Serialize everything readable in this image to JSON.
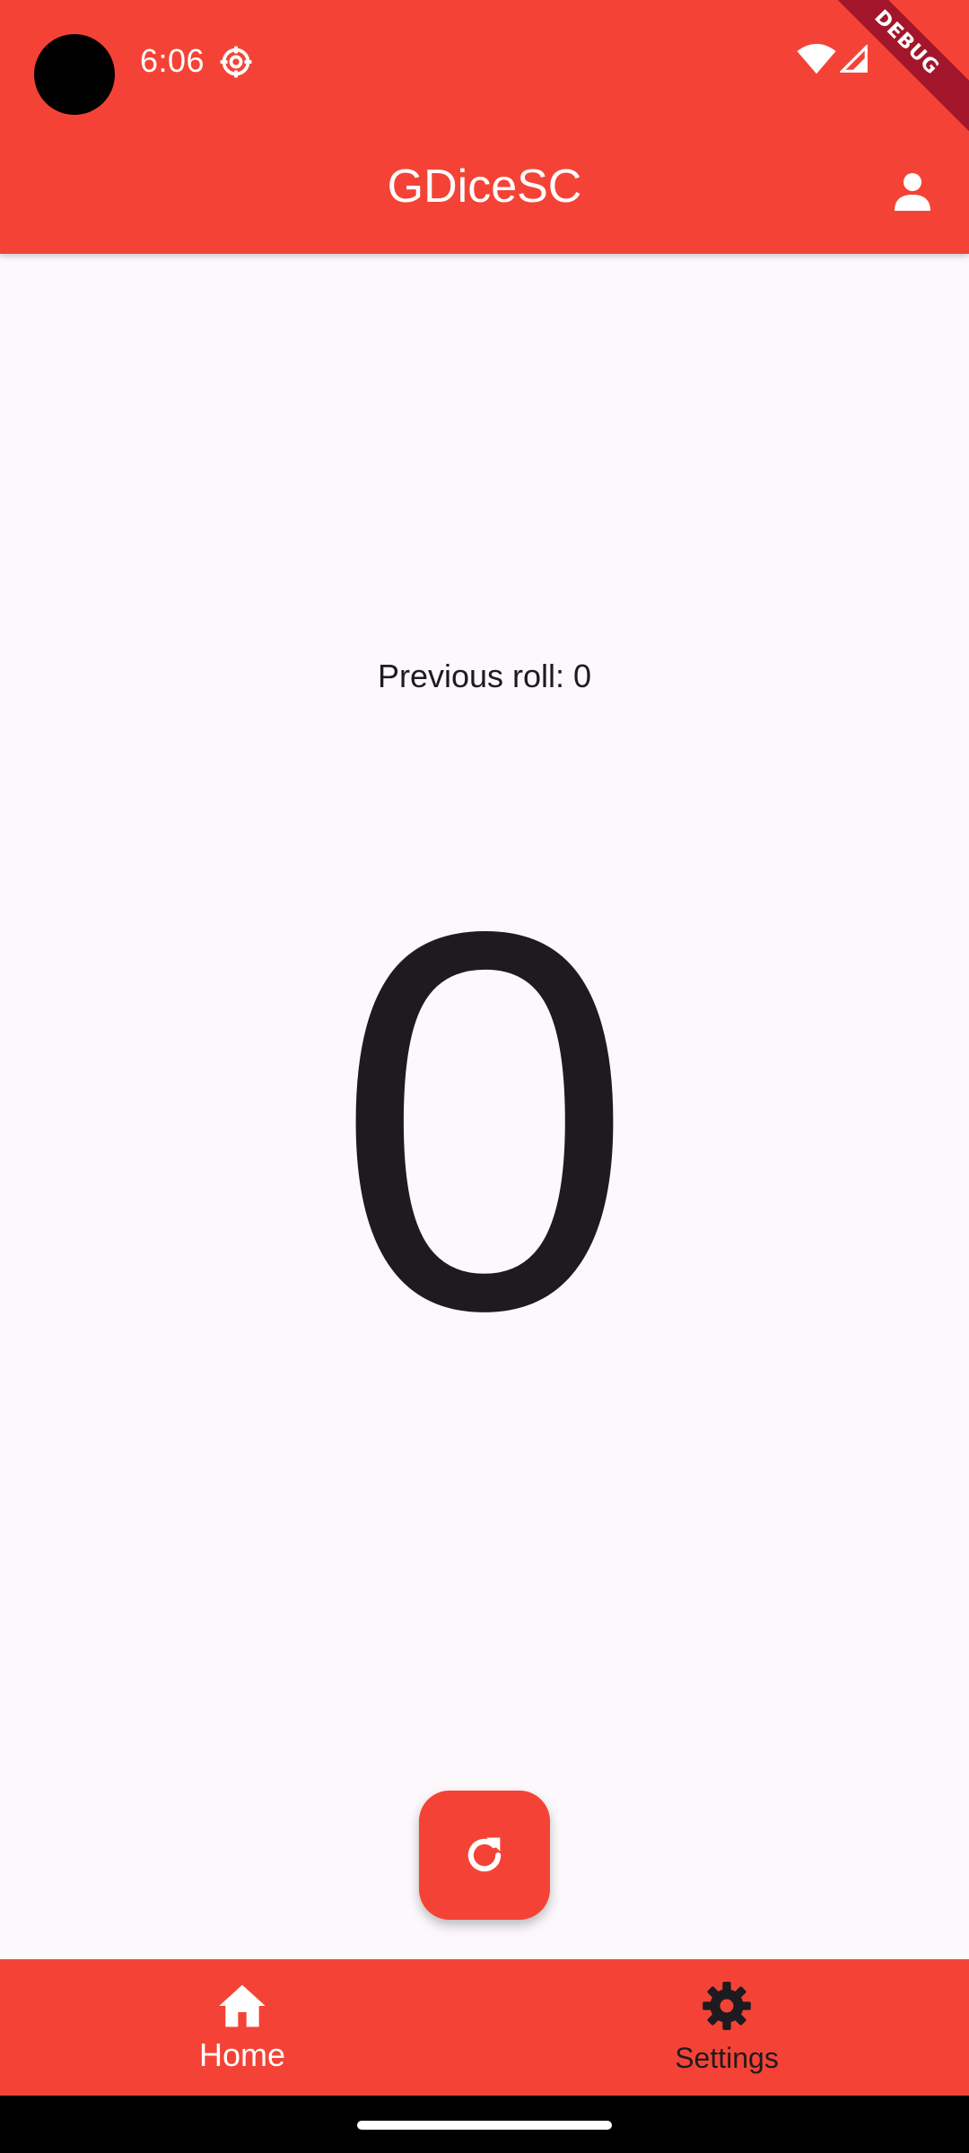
{
  "status_bar": {
    "time": "6:06",
    "settings_icon": "gear-outline-icon",
    "wifi_icon": "wifi-icon",
    "signal_icon": "cell-signal-icon"
  },
  "debug_banner": "DEBUG",
  "app_bar": {
    "title": "GDiceSC",
    "account_icon": "person-icon"
  },
  "main": {
    "previous_roll_label": "Previous roll: 0",
    "current_roll": "0"
  },
  "fab": {
    "icon": "refresh-icon"
  },
  "bottom_nav": {
    "items": [
      {
        "label": "Home",
        "icon": "home-icon",
        "selected": true
      },
      {
        "label": "Settings",
        "icon": "gear-icon",
        "selected": false
      }
    ]
  },
  "colors": {
    "primary": "#f44336",
    "background": "#fcf8fb",
    "text": "#1d1b20",
    "on_primary": "#ffffff"
  }
}
